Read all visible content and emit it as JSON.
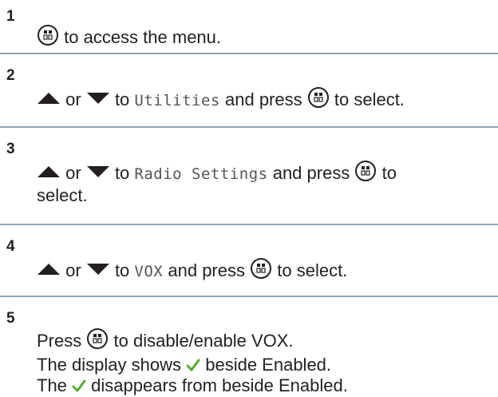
{
  "steps": [
    {
      "number": "1",
      "text_1": "to access the menu."
    },
    {
      "number": "2",
      "or": "or",
      "to": "to",
      "menu_item": "Utilities",
      "text_2": "and press",
      "text_3": "to select."
    },
    {
      "number": "3",
      "or": "or",
      "to": "to",
      "menu_item": "Radio Settings",
      "text_2": "and press",
      "text_3": "to",
      "text_4": "select."
    },
    {
      "number": "4",
      "or": "or",
      "to": "to",
      "menu_item": "VOX",
      "text_2": "and press",
      "text_3": "to select."
    },
    {
      "number": "5",
      "text_1": "Press",
      "text_2": "to disable/enable VOX.",
      "line_2_a": "The display shows",
      "line_2_b": "beside Enabled.",
      "line_3_a": "The",
      "line_3_b": "disappears from beside Enabled."
    }
  ],
  "icons": {
    "ok_button": "ok-menu-button-icon",
    "up": "up-arrow-icon",
    "down": "down-arrow-icon",
    "check": "checkmark-icon"
  },
  "colors": {
    "divider": "#8fa3b8",
    "check": "#5aa832",
    "text": "#231f20"
  }
}
